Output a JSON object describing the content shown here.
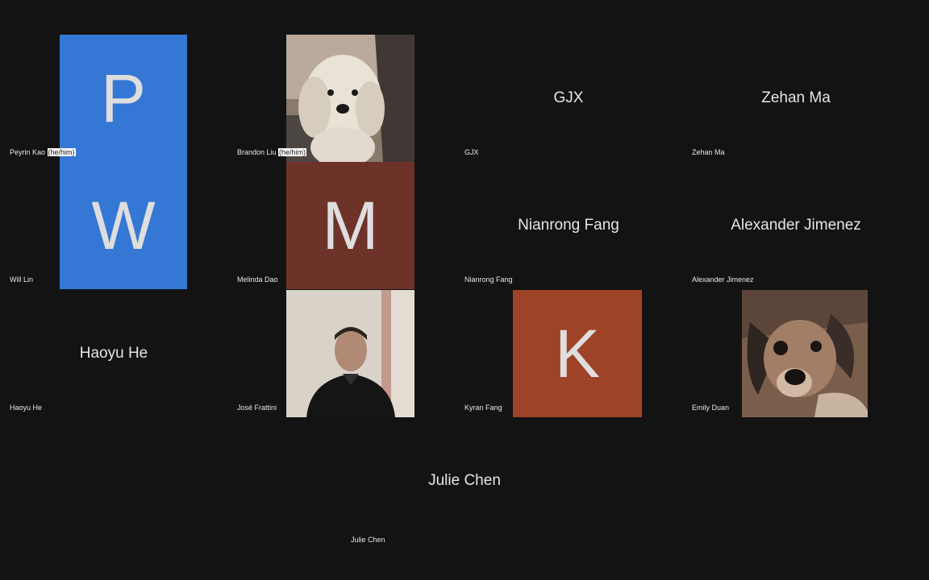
{
  "colors": {
    "background": "#131313",
    "avatar_blue": "#3477d5",
    "avatar_maroon": "#6e3328",
    "avatar_orange": "#9e4228"
  },
  "tiles": {
    "peyrin": {
      "initial": "P",
      "name_prefix": "Peyrin Kao ",
      "name_suffix": "(he/him)"
    },
    "brandon": {
      "photo": "dog-photo",
      "name_prefix": "Brandon Liu ",
      "name_suffix": "(he/him)"
    },
    "gjx": {
      "display": "GJX",
      "name": "GJX"
    },
    "zehan": {
      "display": "Zehan Ma",
      "name": "Zehan Ma"
    },
    "will": {
      "initial": "W",
      "name": "Will Lin"
    },
    "melinda": {
      "initial": "M",
      "name": "Melinda Dao"
    },
    "nianrong": {
      "display": "Nianrong Fang",
      "name": "Nianrong Fang"
    },
    "alexander": {
      "display": "Alexander Jimenez",
      "name": "Alexander Jimenez"
    },
    "haoyu": {
      "display": "Haoyu He",
      "name": "Haoyu He"
    },
    "jose": {
      "photo": "person-photo",
      "name": "José Frattini"
    },
    "kyran": {
      "initial": "K",
      "name": "Kyran Fang"
    },
    "emily": {
      "photo": "dog-photo",
      "name": "Emily Duan"
    },
    "julie": {
      "display": "Julie Chen",
      "name": "Julie Chen"
    }
  }
}
